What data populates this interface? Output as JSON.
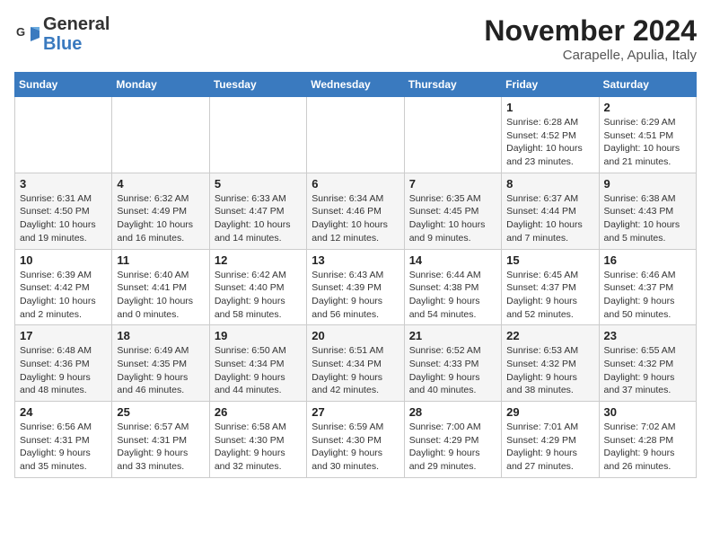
{
  "header": {
    "logo_general": "General",
    "logo_blue": "Blue",
    "month_title": "November 2024",
    "subtitle": "Carapelle, Apulia, Italy"
  },
  "days_of_week": [
    "Sunday",
    "Monday",
    "Tuesday",
    "Wednesday",
    "Thursday",
    "Friday",
    "Saturday"
  ],
  "weeks": [
    {
      "days": [
        {
          "num": "",
          "info": ""
        },
        {
          "num": "",
          "info": ""
        },
        {
          "num": "",
          "info": ""
        },
        {
          "num": "",
          "info": ""
        },
        {
          "num": "",
          "info": ""
        },
        {
          "num": "1",
          "info": "Sunrise: 6:28 AM\nSunset: 4:52 PM\nDaylight: 10 hours and 23 minutes."
        },
        {
          "num": "2",
          "info": "Sunrise: 6:29 AM\nSunset: 4:51 PM\nDaylight: 10 hours and 21 minutes."
        }
      ]
    },
    {
      "days": [
        {
          "num": "3",
          "info": "Sunrise: 6:31 AM\nSunset: 4:50 PM\nDaylight: 10 hours and 19 minutes."
        },
        {
          "num": "4",
          "info": "Sunrise: 6:32 AM\nSunset: 4:49 PM\nDaylight: 10 hours and 16 minutes."
        },
        {
          "num": "5",
          "info": "Sunrise: 6:33 AM\nSunset: 4:47 PM\nDaylight: 10 hours and 14 minutes."
        },
        {
          "num": "6",
          "info": "Sunrise: 6:34 AM\nSunset: 4:46 PM\nDaylight: 10 hours and 12 minutes."
        },
        {
          "num": "7",
          "info": "Sunrise: 6:35 AM\nSunset: 4:45 PM\nDaylight: 10 hours and 9 minutes."
        },
        {
          "num": "8",
          "info": "Sunrise: 6:37 AM\nSunset: 4:44 PM\nDaylight: 10 hours and 7 minutes."
        },
        {
          "num": "9",
          "info": "Sunrise: 6:38 AM\nSunset: 4:43 PM\nDaylight: 10 hours and 5 minutes."
        }
      ]
    },
    {
      "days": [
        {
          "num": "10",
          "info": "Sunrise: 6:39 AM\nSunset: 4:42 PM\nDaylight: 10 hours and 2 minutes."
        },
        {
          "num": "11",
          "info": "Sunrise: 6:40 AM\nSunset: 4:41 PM\nDaylight: 10 hours and 0 minutes."
        },
        {
          "num": "12",
          "info": "Sunrise: 6:42 AM\nSunset: 4:40 PM\nDaylight: 9 hours and 58 minutes."
        },
        {
          "num": "13",
          "info": "Sunrise: 6:43 AM\nSunset: 4:39 PM\nDaylight: 9 hours and 56 minutes."
        },
        {
          "num": "14",
          "info": "Sunrise: 6:44 AM\nSunset: 4:38 PM\nDaylight: 9 hours and 54 minutes."
        },
        {
          "num": "15",
          "info": "Sunrise: 6:45 AM\nSunset: 4:37 PM\nDaylight: 9 hours and 52 minutes."
        },
        {
          "num": "16",
          "info": "Sunrise: 6:46 AM\nSunset: 4:37 PM\nDaylight: 9 hours and 50 minutes."
        }
      ]
    },
    {
      "days": [
        {
          "num": "17",
          "info": "Sunrise: 6:48 AM\nSunset: 4:36 PM\nDaylight: 9 hours and 48 minutes."
        },
        {
          "num": "18",
          "info": "Sunrise: 6:49 AM\nSunset: 4:35 PM\nDaylight: 9 hours and 46 minutes."
        },
        {
          "num": "19",
          "info": "Sunrise: 6:50 AM\nSunset: 4:34 PM\nDaylight: 9 hours and 44 minutes."
        },
        {
          "num": "20",
          "info": "Sunrise: 6:51 AM\nSunset: 4:34 PM\nDaylight: 9 hours and 42 minutes."
        },
        {
          "num": "21",
          "info": "Sunrise: 6:52 AM\nSunset: 4:33 PM\nDaylight: 9 hours and 40 minutes."
        },
        {
          "num": "22",
          "info": "Sunrise: 6:53 AM\nSunset: 4:32 PM\nDaylight: 9 hours and 38 minutes."
        },
        {
          "num": "23",
          "info": "Sunrise: 6:55 AM\nSunset: 4:32 PM\nDaylight: 9 hours and 37 minutes."
        }
      ]
    },
    {
      "days": [
        {
          "num": "24",
          "info": "Sunrise: 6:56 AM\nSunset: 4:31 PM\nDaylight: 9 hours and 35 minutes."
        },
        {
          "num": "25",
          "info": "Sunrise: 6:57 AM\nSunset: 4:31 PM\nDaylight: 9 hours and 33 minutes."
        },
        {
          "num": "26",
          "info": "Sunrise: 6:58 AM\nSunset: 4:30 PM\nDaylight: 9 hours and 32 minutes."
        },
        {
          "num": "27",
          "info": "Sunrise: 6:59 AM\nSunset: 4:30 PM\nDaylight: 9 hours and 30 minutes."
        },
        {
          "num": "28",
          "info": "Sunrise: 7:00 AM\nSunset: 4:29 PM\nDaylight: 9 hours and 29 minutes."
        },
        {
          "num": "29",
          "info": "Sunrise: 7:01 AM\nSunset: 4:29 PM\nDaylight: 9 hours and 27 minutes."
        },
        {
          "num": "30",
          "info": "Sunrise: 7:02 AM\nSunset: 4:28 PM\nDaylight: 9 hours and 26 minutes."
        }
      ]
    }
  ]
}
